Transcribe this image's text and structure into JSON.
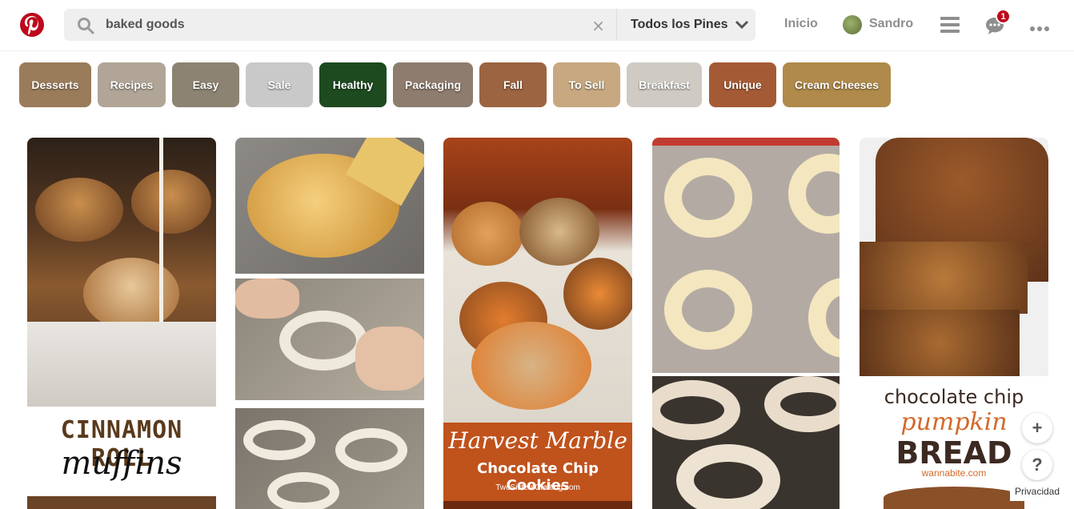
{
  "header": {
    "search_value": "baked goods",
    "clear_glyph": "×",
    "scope_label": "Todos los Pines",
    "home_label": "Inicio",
    "user_name": "Sandro",
    "notification_count": "1",
    "brand_color": "#bd081c"
  },
  "chips": [
    {
      "label": "Desserts",
      "color": "#9a7b5a"
    },
    {
      "label": "Recipes",
      "color": "#b0a596"
    },
    {
      "label": "Easy",
      "color": "#8d8372"
    },
    {
      "label": "Sale",
      "color": "#c9c9c9"
    },
    {
      "label": "Healthy",
      "color": "#1e4a20"
    },
    {
      "label": "Packaging",
      "color": "#8e7c6e"
    },
    {
      "label": "Fall",
      "color": "#9c6440"
    },
    {
      "label": "To Sell",
      "color": "#c7a880"
    },
    {
      "label": "Breakfast",
      "color": "#cfcbc4"
    },
    {
      "label": "Unique",
      "color": "#a45b35"
    },
    {
      "label": "Cream Cheeses",
      "color": "#b08a4a"
    }
  ],
  "pins": {
    "pin1": {
      "line1": "CINNAMON ROLL",
      "line2": "muffins"
    },
    "pin3": {
      "line1": "Harvest Marble",
      "line2": "Chocolate Chip Cookies",
      "credit": "TwoSistersCrafting.com"
    },
    "pin5": {
      "line1": "chocolate chip",
      "line2": "pumpkin",
      "line3": "BREAD",
      "credit": "wannabite.com"
    }
  },
  "fab": {
    "plus": "+",
    "help": "?"
  },
  "privacy_label": "Privacidad"
}
